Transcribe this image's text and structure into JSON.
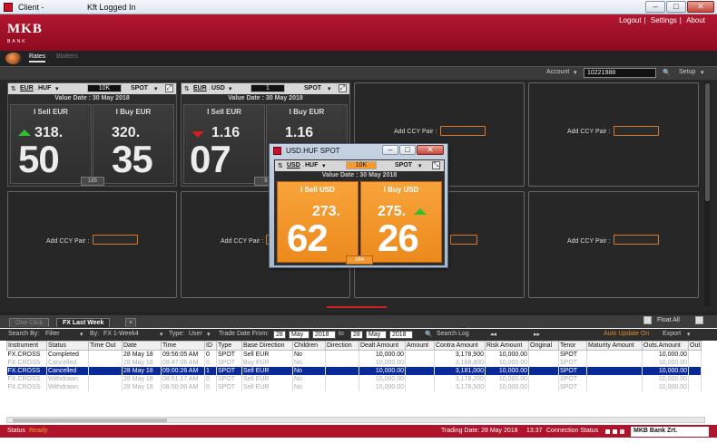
{
  "window": {
    "title": "Client -",
    "subtitle": "Kft Logged In"
  },
  "header": {
    "logo": "MKB",
    "logo_sub": "BANK",
    "links": [
      "Logout",
      "Settings",
      "About"
    ]
  },
  "nav": {
    "tabs": [
      "Rates",
      "Blotters"
    ]
  },
  "toolbar": {
    "account_label": "Account",
    "account_value": "10221988",
    "setup_label": "Setup"
  },
  "tiles": [
    {
      "pair_base": "EUR",
      "pair_quote": "HUF",
      "amount": "10K",
      "tenor": "SPOT",
      "value_date": "Value Date : 30 May 2018",
      "sell_label": "I Sell EUR",
      "buy_label": "I Buy EUR",
      "sell_small": "318.",
      "sell_big": "50",
      "buy_small": "320.",
      "buy_big": "35",
      "spread": "185"
    },
    {
      "pair_base": "EUR",
      "pair_quote": "USD",
      "amount": "1",
      "tenor": "SPOT",
      "value_date": "Value Date : 30 May 2018",
      "sell_label": "I Sell EUR",
      "buy_label": "I Buy EUR",
      "sell_small": "1.16",
      "sell_big": "07",
      "buy_small": "1.16",
      "buy_big": "",
      "spread": "6"
    }
  ],
  "add_ccy_label": "Add CCY Pair :",
  "popup": {
    "title": "USD.HUF SPOT",
    "pair_base": "USD",
    "pair_quote": "HUF",
    "amount": "10K",
    "tenor": "SPOT",
    "value_date": "Value Date : 30 May 2018",
    "sell_label": "I Sell USD",
    "buy_label": "I Buy USD",
    "sell_small": "273.",
    "sell_big": "62",
    "buy_small": "275.",
    "buy_big": "26",
    "spread": "164"
  },
  "blotter": {
    "tabs": [
      "One Click",
      "FX Last Week"
    ],
    "float_all": "Float All",
    "search_by": "Search By:",
    "filter": "Filter",
    "by": "By:",
    "by_value": "FX 1-Week4",
    "type": "Type:",
    "type_value": "User",
    "trade_date_from": "Trade Date From:",
    "from_day": "28",
    "from_month": "May",
    "from_year": "2018",
    "to": "to",
    "to_day": "28",
    "to_month": "May",
    "to_year": "2018",
    "search_log": "Search Log",
    "auto_update": "Auto Update On",
    "export": "Export",
    "columns": [
      "Instrument",
      "Status",
      "Time Out",
      "Date",
      "Time",
      "ID",
      "Type",
      "Base Direction",
      "Children",
      "Direction",
      "Dealt Amount",
      "Amount",
      "Contra Amount",
      "Risk Amount",
      "Original",
      "Tenor",
      "Maturity Amount",
      "Outs.Amount",
      "Out"
    ],
    "rows": [
      [
        "FX.CROSS",
        "Completed",
        "",
        "28 May 18",
        "09:56:05 AM",
        "0",
        "SPOT",
        "Sell EUR",
        "No",
        "",
        "10,000.00",
        "",
        "3,178,900",
        "10,000.00",
        "",
        "SPOT",
        "",
        "10,000.00",
        ""
      ],
      [
        "FX.CROSS",
        "Cancelled",
        "",
        "28 May 18",
        "09:47:06 AM",
        "0",
        "SPOT",
        "Buy EUR",
        "No",
        "",
        "10,000.00",
        "",
        "3,188,800",
        "10,000.00",
        "",
        "SPOT",
        "",
        "10,000.00",
        ""
      ],
      [
        "FX.CROSS",
        "Cancelled",
        "",
        "28 May 18",
        "09:00:26 AM",
        "1",
        "SPOT",
        "Sell EUR",
        "No",
        "",
        "10,000.00",
        "",
        "3,181,000",
        "10,000.00",
        "",
        "SPOT",
        "",
        "10,000.00",
        ""
      ],
      [
        "FX.CROSS",
        "Withdrawn",
        "",
        "28 May 18",
        "08:51:17 AM",
        "0",
        "SPOT",
        "Sell EUR",
        "No",
        "",
        "10,000.00",
        "",
        "3,178,200",
        "10,000.00",
        "",
        "SPOT",
        "",
        "10,000.00",
        ""
      ],
      [
        "FX.CROSS",
        "Withdrawn",
        "",
        "28 May 18",
        "08:50:00 AM",
        "0",
        "SPOT",
        "Sell EUR",
        "No",
        "",
        "10,000.00",
        "",
        "3,178,500",
        "10,000.00",
        "",
        "SPOT",
        "",
        "10,000.00",
        ""
      ]
    ]
  },
  "status": {
    "label": "Status",
    "value": "Ready",
    "trading_date": "Trading Date: 28 May 2018",
    "time": "13:37",
    "connection": "Connection Status",
    "bank": "MKB Bank Zrt."
  }
}
